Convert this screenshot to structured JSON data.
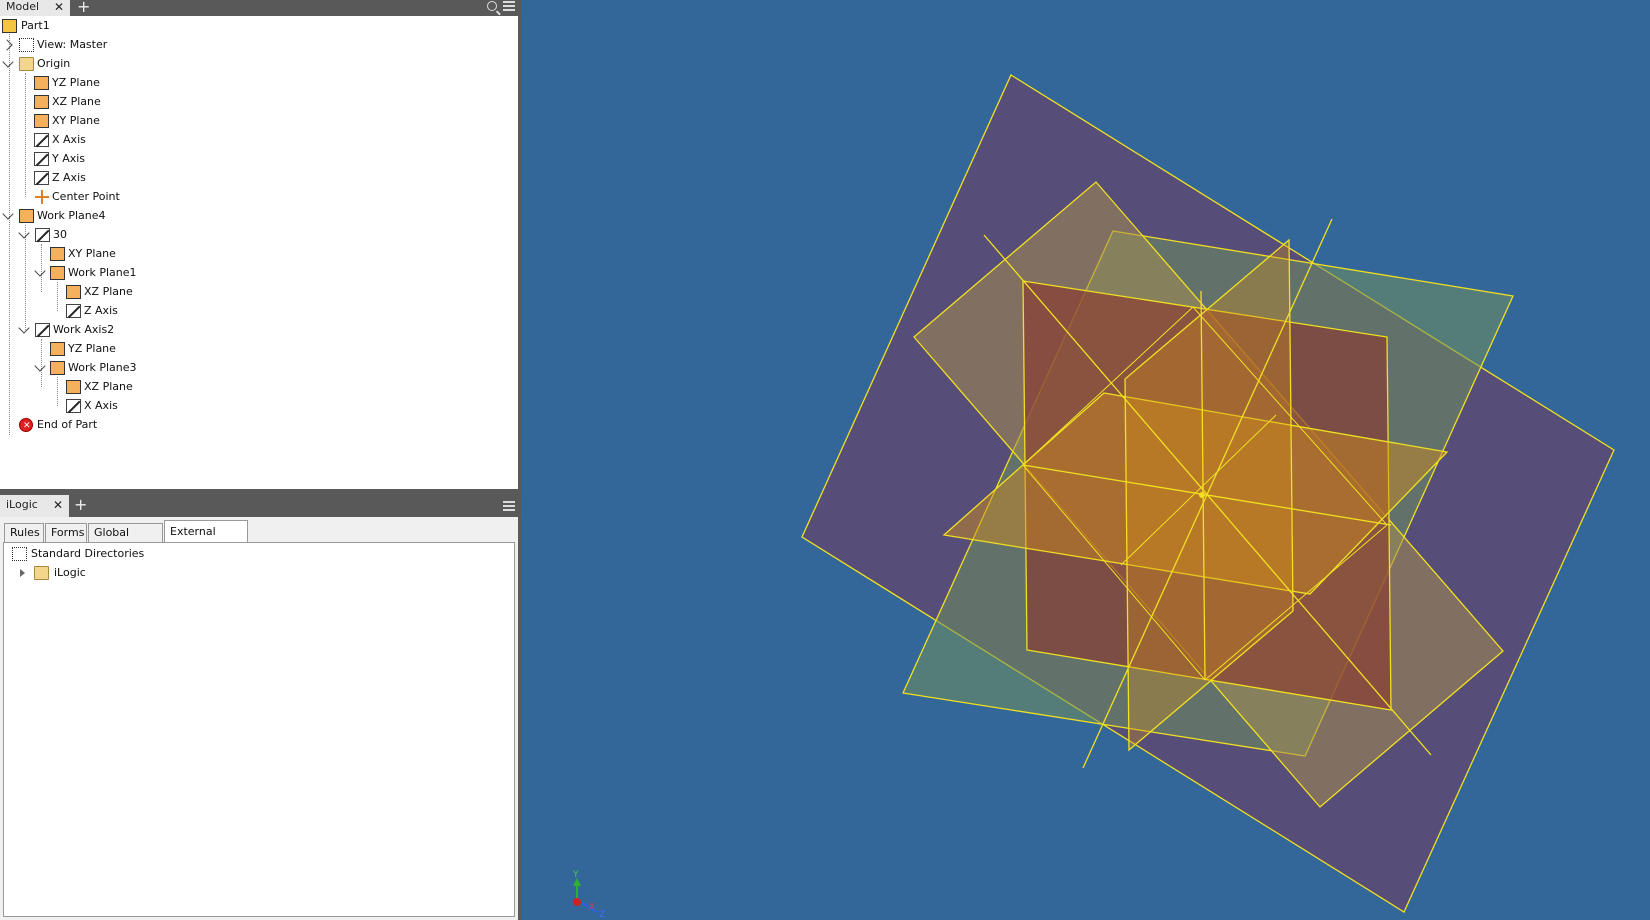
{
  "model_panel": {
    "tab_label": "Model",
    "tree": [
      {
        "label": "Part1"
      },
      {
        "label": "View: Master"
      },
      {
        "label": "Origin"
      },
      {
        "label": "YZ Plane"
      },
      {
        "label": "XZ Plane"
      },
      {
        "label": "XY Plane"
      },
      {
        "label": "X Axis"
      },
      {
        "label": "Y Axis"
      },
      {
        "label": "Z Axis"
      },
      {
        "label": "Center Point"
      },
      {
        "label": "Work Plane4"
      },
      {
        "label": "30"
      },
      {
        "label": "XY Plane"
      },
      {
        "label": "Work Plane1"
      },
      {
        "label": "XZ Plane"
      },
      {
        "label": "Z Axis"
      },
      {
        "label": "Work Axis2"
      },
      {
        "label": "YZ Plane"
      },
      {
        "label": "Work Plane3"
      },
      {
        "label": "XZ Plane"
      },
      {
        "label": "X Axis"
      },
      {
        "label": "End of Part"
      }
    ]
  },
  "ilogic_panel": {
    "tab_label": "iLogic",
    "tabs": [
      "Rules",
      "Forms",
      "Global Forms",
      "External Rules"
    ],
    "active_tab": "External Rules",
    "root_label": "Standard Directories",
    "child_label": "iLogic"
  },
  "viewport": {
    "background": "#336699",
    "plane_stroke": "#f0e020",
    "triad_labels": {
      "y": "Y",
      "x": "X",
      "z": "Z"
    }
  }
}
